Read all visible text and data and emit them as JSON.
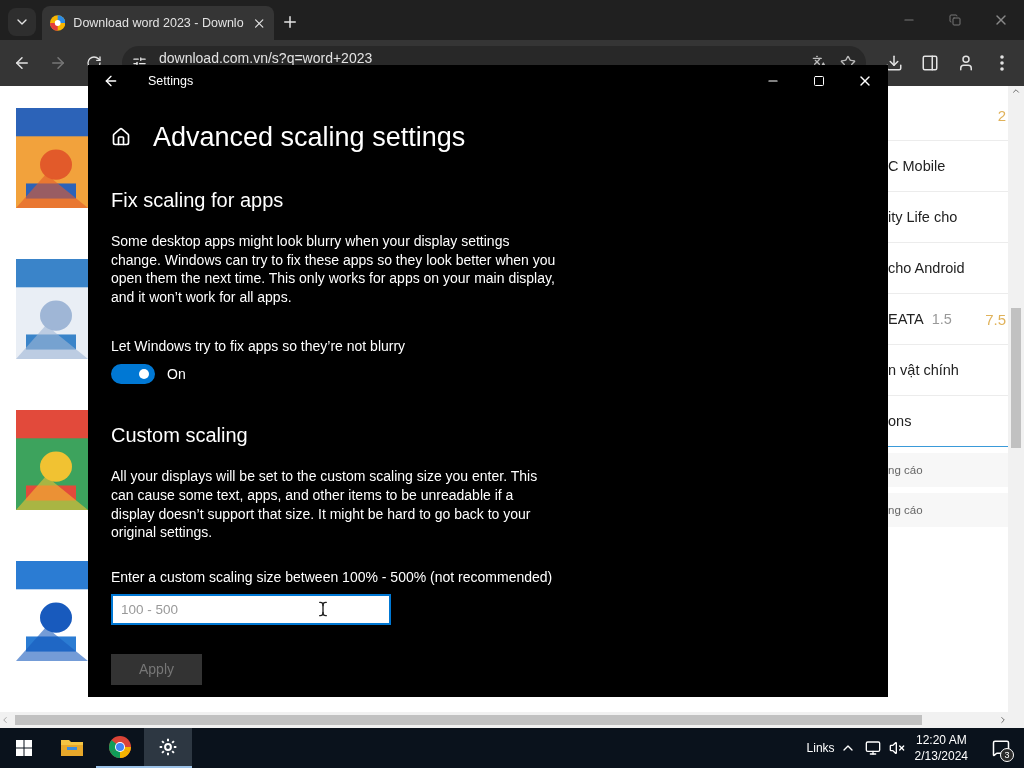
{
  "browser": {
    "tab": {
      "title": "Download word 2023 - Downlo",
      "selected": true
    },
    "address": "download.com.vn/s?q=word+2023",
    "forward_disabled": true,
    "page": {
      "thumbnails": [
        {
          "kind": "picture"
        },
        {
          "kind": "picture"
        },
        {
          "kind": "picture"
        },
        {
          "kind": "picture"
        }
      ],
      "list": [
        {
          "rating": "2"
        },
        {
          "title": "C Mobile"
        },
        {
          "title": "ity Life cho"
        },
        {
          "title": "cho Android"
        },
        {
          "title": "EATA",
          "version": "1.5",
          "rating": "7.5"
        },
        {
          "title": "n vật chính"
        },
        {
          "title": "ons",
          "selected": true
        }
      ],
      "ads": [
        "ng cáo",
        "ng cáo"
      ]
    }
  },
  "settings": {
    "window": {
      "title": "Settings"
    },
    "heading": "Advanced scaling settings",
    "sections": [
      {
        "title": "Fix scaling for apps",
        "text": "Some desktop apps might look blurry when your display settings change. Windows can try to fix these apps so they look better when you open them the next time. This only works for apps on your main display, and it won’t work for all apps.",
        "kind": "toggle",
        "label": "Let Windows try to fix apps so they’re not blurry",
        "on": true,
        "state_text": "On"
      },
      {
        "title": "Custom scaling",
        "text": "All your displays will be set to the custom scaling size you enter. This can cause some text, apps, and other items to be unreadable if a display doesn’t support that size. It might be hard to go back to your original settings.",
        "kind": "input",
        "label": "Enter a custom scaling size between 100% - 500% (not recommended)",
        "placeholder": "100 - 500",
        "focused": true,
        "button": {
          "label": "Apply",
          "disabled": true
        }
      }
    ]
  },
  "taskbar": {
    "apps": [
      {
        "kind": "explorer",
        "running": false,
        "selected": false
      },
      {
        "kind": "chrome",
        "running": true,
        "selected": false
      },
      {
        "kind": "settings",
        "running": true,
        "selected": true
      }
    ],
    "links": "Links",
    "time": "12:20 AM",
    "date": "2/13/2024",
    "notifications": "3"
  }
}
